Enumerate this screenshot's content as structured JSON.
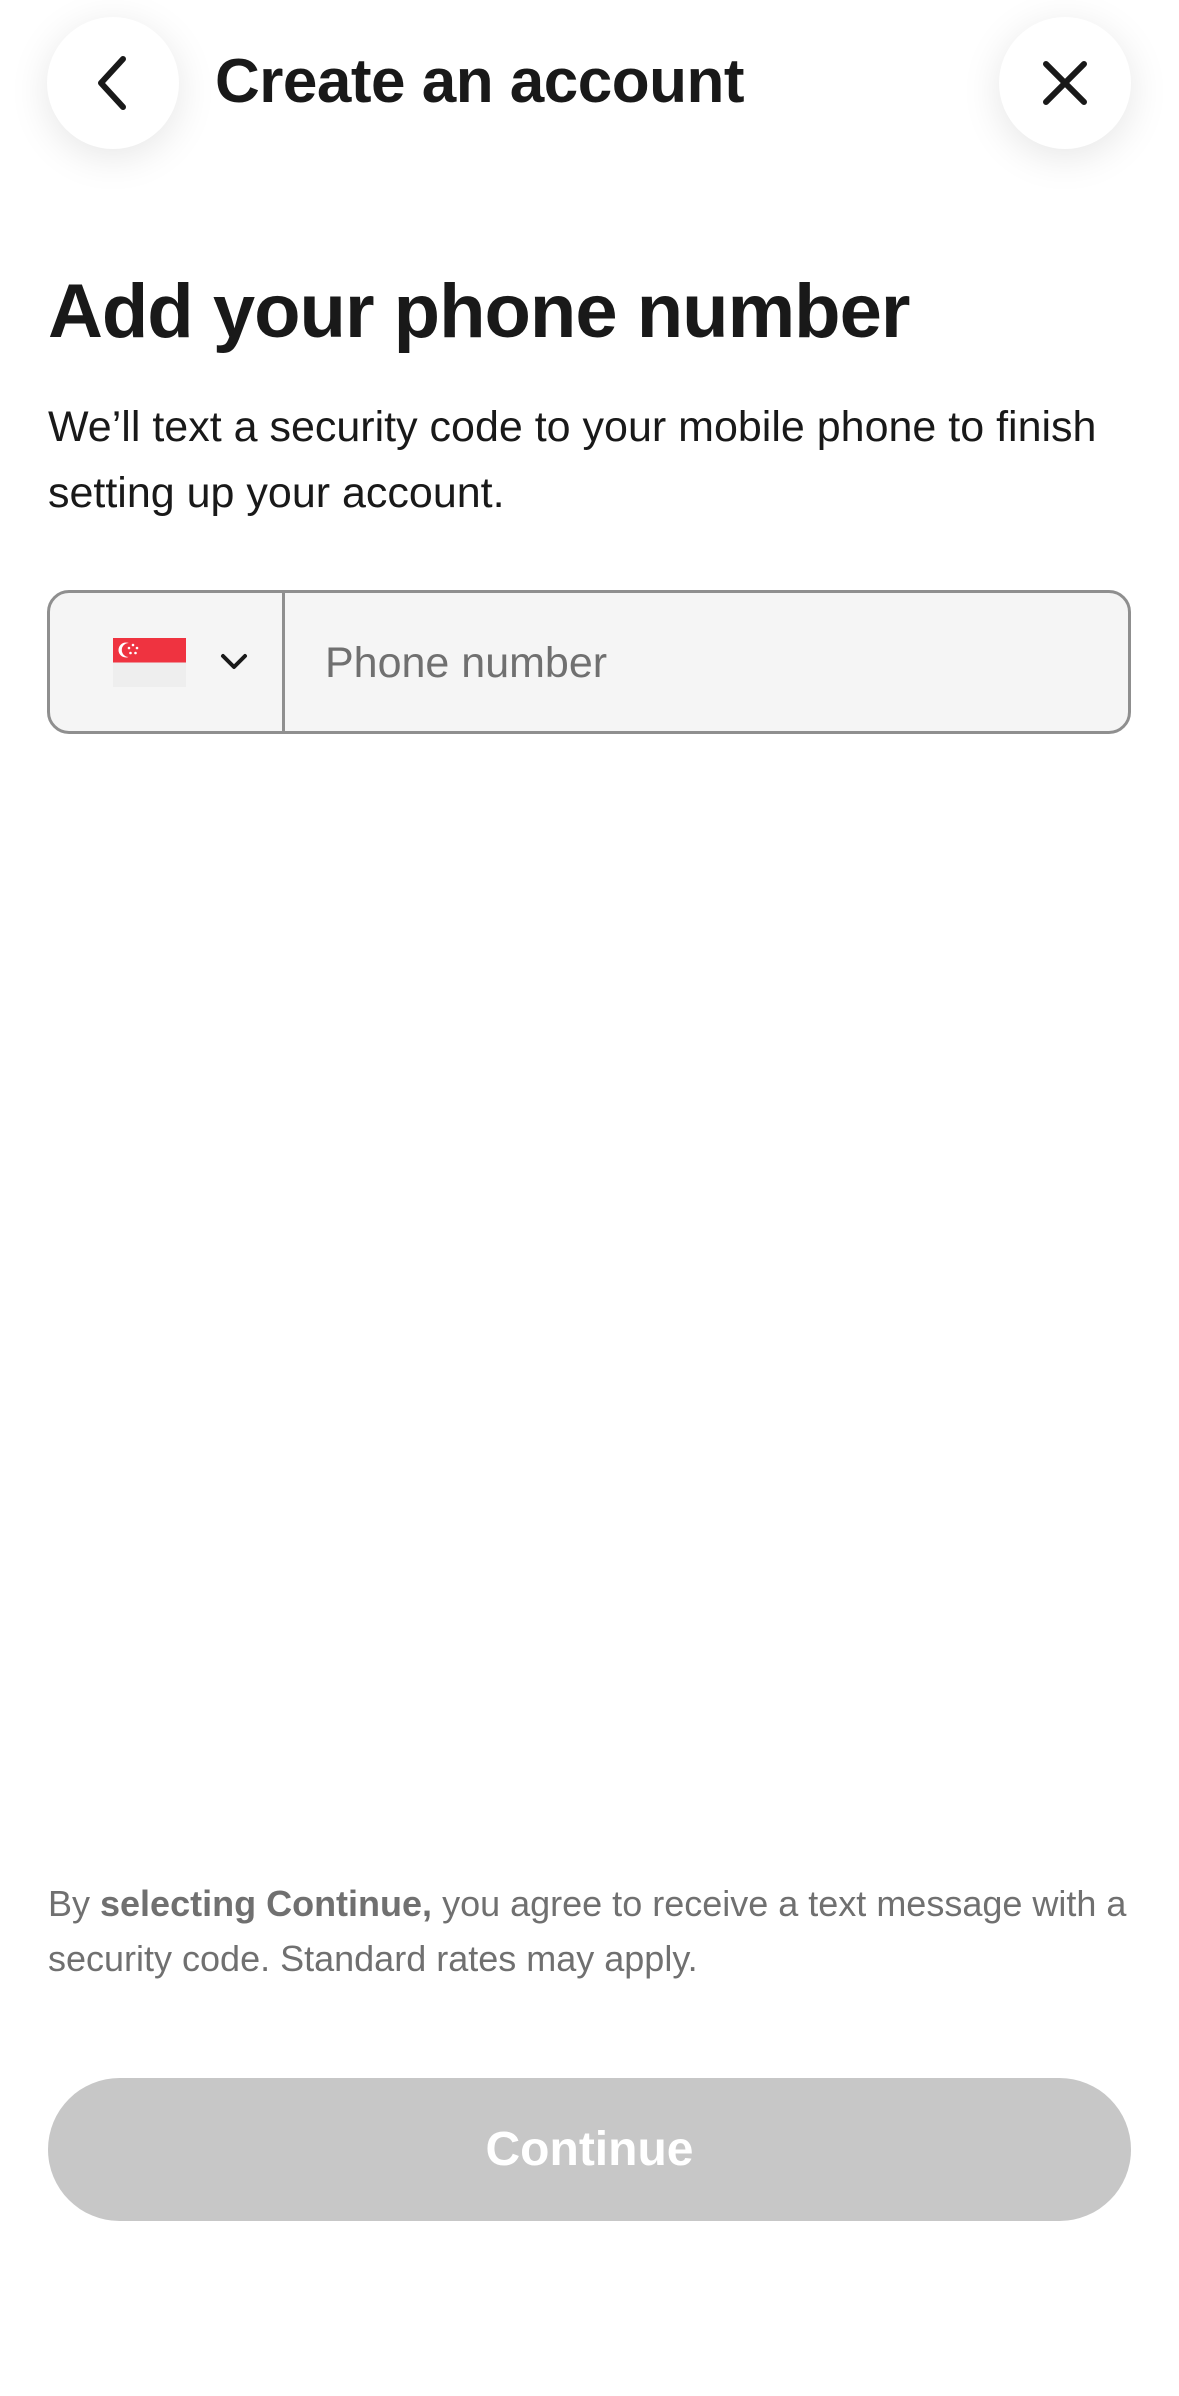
{
  "header": {
    "title": "Create an account",
    "back_icon": "chevron-left-icon",
    "close_icon": "close-icon"
  },
  "main": {
    "title": "Add your phone number",
    "subtitle": "We’ll text a security code to your mobile phone to finish setting up your account."
  },
  "phone": {
    "country_flag_icon": "singapore-flag-icon",
    "dropdown_icon": "chevron-down-icon",
    "placeholder": "Phone number",
    "value": ""
  },
  "disclaimer": {
    "prefix": "By ",
    "bold": "selecting Continue,",
    "suffix": " you agree to receive a text message with a security code. Standard rates may apply."
  },
  "footer": {
    "continue_label": "Continue"
  },
  "colors": {
    "text": "#191919",
    "muted_text": "#707070",
    "input_border": "#8f8f8f",
    "input_bg": "#f5f5f5",
    "button_disabled_bg": "#c7c7c7",
    "flag_red": "#ef3340"
  }
}
